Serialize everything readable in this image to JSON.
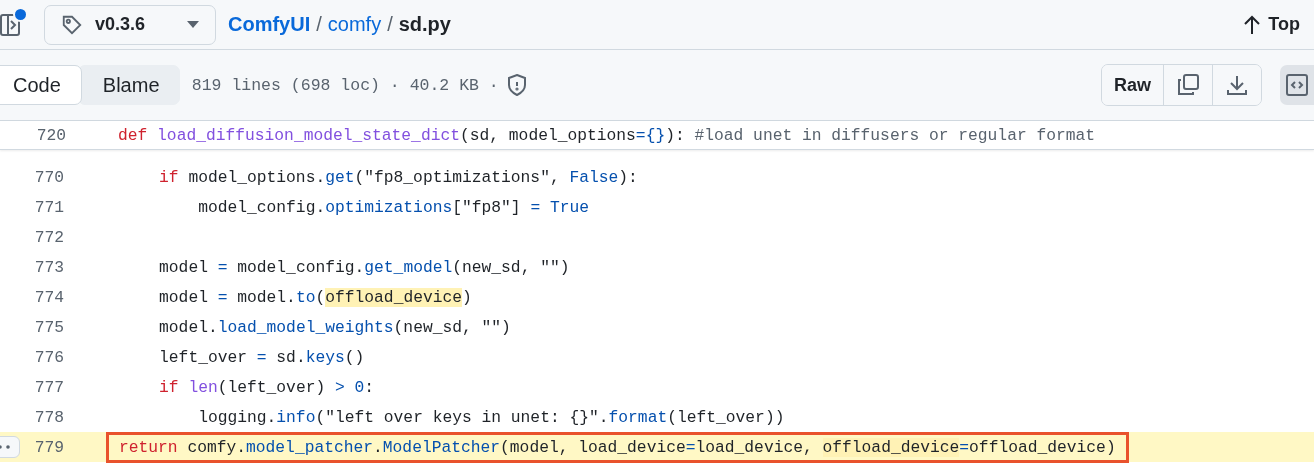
{
  "header": {
    "branch": "v0.3.6",
    "breadcrumb": [
      {
        "label": "ComfyUI",
        "kind": "link"
      },
      {
        "label": "comfy",
        "kind": "link"
      },
      {
        "label": "sd.py",
        "kind": "current"
      }
    ],
    "separator": "/",
    "top_link": "Top",
    "notification": true
  },
  "toolbar": {
    "tabs": [
      {
        "label": "Code",
        "selected": true
      },
      {
        "label": "Blame",
        "selected": false
      }
    ],
    "file_info": "819 lines (698 loc) · 40.2 KB ·",
    "raw_button": "Raw",
    "symbols_selected": true
  },
  "sticky_line": {
    "number": "720",
    "tokens": [
      {
        "kind": "kw",
        "text": "def "
      },
      {
        "kind": "def",
        "text": "load_diffusion_model_state_dict"
      },
      {
        "kind": "plain",
        "text": "(sd, model_options"
      },
      {
        "kind": "op",
        "text": "={}"
      },
      {
        "kind": "plain",
        "text": "): "
      },
      {
        "kind": "comment",
        "text": "#load unet in diffusers or regular format"
      }
    ]
  },
  "lines": [
    {
      "number": "770",
      "selected": false,
      "boxed": false,
      "tokens": [
        {
          "kind": "kw",
          "text": "    if"
        },
        {
          "kind": "plain",
          "text": " model_options."
        },
        {
          "kind": "call",
          "text": "get"
        },
        {
          "kind": "plain",
          "text": "(\"fp8_optimizations\", "
        },
        {
          "kind": "const",
          "text": "False"
        },
        {
          "kind": "plain",
          "text": "):"
        }
      ]
    },
    {
      "number": "771",
      "selected": false,
      "boxed": false,
      "tokens": [
        {
          "kind": "plain",
          "text": "        model_config."
        },
        {
          "kind": "call",
          "text": "optimizations"
        },
        {
          "kind": "plain",
          "text": "[\"fp8\"] "
        },
        {
          "kind": "op",
          "text": "= "
        },
        {
          "kind": "const",
          "text": "True"
        }
      ]
    },
    {
      "number": "772",
      "selected": false
    },
    {
      "number": "773",
      "selected": false,
      "boxed": false,
      "tokens": [
        {
          "kind": "plain",
          "text": "    model "
        },
        {
          "kind": "op",
          "text": "="
        },
        {
          "kind": "plain",
          "text": " model_config."
        },
        {
          "kind": "call",
          "text": "get_model"
        },
        {
          "kind": "plain",
          "text": "(new_sd, \"\")"
        }
      ]
    },
    {
      "number": "774",
      "selected": false,
      "boxed": false,
      "tokens": [
        {
          "kind": "plain",
          "text": "    model "
        },
        {
          "kind": "op",
          "text": "="
        },
        {
          "kind": "plain",
          "text": " model."
        },
        {
          "kind": "call",
          "text": "to"
        },
        {
          "kind": "plain",
          "text": "("
        },
        {
          "kind": "match",
          "text": "offload_device"
        },
        {
          "kind": "plain",
          "text": ")"
        }
      ]
    },
    {
      "number": "775",
      "selected": false,
      "boxed": false,
      "tokens": [
        {
          "kind": "plain",
          "text": "    model."
        },
        {
          "kind": "call",
          "text": "load_model_weights"
        },
        {
          "kind": "plain",
          "text": "(new_sd, \"\")"
        }
      ]
    },
    {
      "number": "776",
      "selected": false,
      "boxed": false,
      "tokens": [
        {
          "kind": "plain",
          "text": "    left_over "
        },
        {
          "kind": "op",
          "text": "="
        },
        {
          "kind": "plain",
          "text": " sd."
        },
        {
          "kind": "call",
          "text": "keys"
        },
        {
          "kind": "plain",
          "text": "()"
        }
      ]
    },
    {
      "number": "777",
      "selected": false,
      "boxed": false,
      "tokens": [
        {
          "kind": "kw",
          "text": "    if "
        },
        {
          "kind": "def",
          "text": "len"
        },
        {
          "kind": "plain",
          "text": "(left_over) "
        },
        {
          "kind": "op",
          "text": "> "
        },
        {
          "kind": "const",
          "text": "0"
        },
        {
          "kind": "plain",
          "text": ":"
        }
      ]
    },
    {
      "number": "778",
      "selected": false,
      "boxed": false,
      "tokens": [
        {
          "kind": "plain",
          "text": "        logging."
        },
        {
          "kind": "call",
          "text": "info"
        },
        {
          "kind": "plain",
          "text": "(\"left over keys in unet: {}\"."
        },
        {
          "kind": "call",
          "text": "format"
        },
        {
          "kind": "plain",
          "text": "(left_over))"
        }
      ]
    },
    {
      "number": "779",
      "selected": true,
      "boxed": true,
      "tokens": [
        {
          "kind": "kw",
          "text": "return"
        },
        {
          "kind": "plain",
          "text": " comfy."
        },
        {
          "kind": "call",
          "text": "model_patcher"
        },
        {
          "kind": "plain",
          "text": "."
        },
        {
          "kind": "call",
          "text": "ModelPatcher"
        },
        {
          "kind": "plain",
          "text": "(model, load_device"
        },
        {
          "kind": "op",
          "text": "="
        },
        {
          "kind": "plain",
          "text": "load_device, "
        },
        {
          "kind": "match",
          "text": "offload_device"
        },
        {
          "kind": "op",
          "text": "="
        },
        {
          "kind": "plain",
          "text": "offload_device)"
        }
      ]
    }
  ]
}
